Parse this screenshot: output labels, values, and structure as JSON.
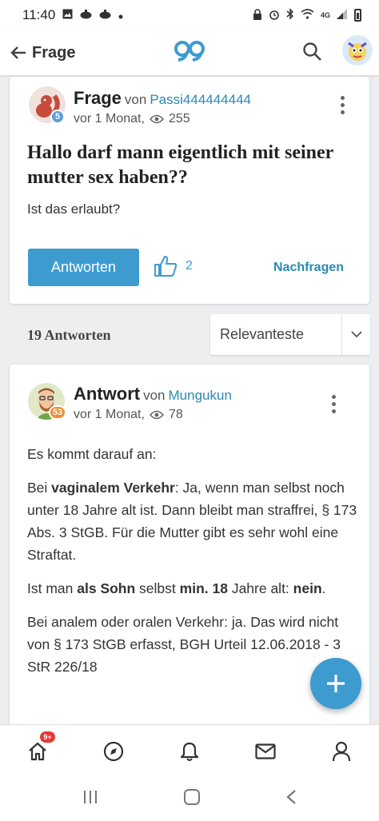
{
  "status_bar": {
    "time": "11:40",
    "network": "4G"
  },
  "app_bar": {
    "title": "Frage"
  },
  "question": {
    "kind": "Frage",
    "von": "von",
    "author": "Passi444444444",
    "level": "5",
    "age": "vor 1 Monat,",
    "views": "255",
    "title": "Hallo darf mann eigentlich mit seiner mutter sex haben??",
    "body": "Ist das erlaubt?",
    "answer_button": "Antworten",
    "likes": "2",
    "ask_link": "Nachfragen"
  },
  "answers_header": {
    "count_label": "19 Antworten",
    "sort_selected": "Relevanteste"
  },
  "answer": {
    "kind": "Antwort",
    "von": "von",
    "author": "Mungukun",
    "level": "53",
    "age": "vor 1 Monat,",
    "views": "78",
    "p1": "Es kommt darauf an:",
    "p2a": "Bei ",
    "p2b": "vaginalem Verkehr",
    "p2c": ": Ja, wenn man selbst noch unter 18 Jahre alt ist. Dann bleibt man straffrei, § 173 Abs. 3 StGB. Für die Mutter gibt es sehr wohl eine Straftat.",
    "p3a": "Ist man ",
    "p3b": "als Sohn",
    "p3c": " selbst ",
    "p3d": "min. 18",
    "p3e": " Jahre alt: ",
    "p3f": "nein",
    "p3g": ".",
    "p4": "Bei analem oder oralen Verkehr: ja. Das wird nicht von § 173 StGB erfasst, BGH Urteil 12.06.2018 - 3 StR 226/18"
  },
  "bottom_nav": {
    "home_badge": "9+"
  },
  "colors": {
    "accent": "#3d9bd0",
    "link": "#2a8ab0",
    "badge_red": "#e53935",
    "level_blue": "#5aa0d8",
    "level_orange": "#e8913a"
  },
  "icons": [
    "back-arrow-icon",
    "gf-logo-icon",
    "search-icon",
    "eye-icon",
    "thumbs-up-icon",
    "chevron-down-icon",
    "plus-icon",
    "home-icon",
    "compass-icon",
    "bell-icon",
    "mail-icon",
    "user-icon"
  ]
}
